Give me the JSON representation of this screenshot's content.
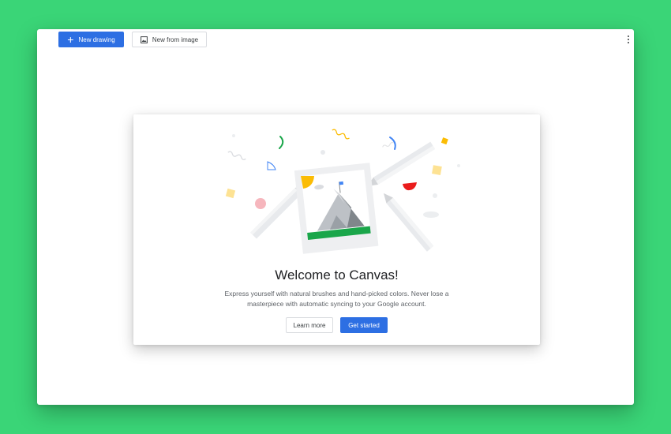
{
  "toolbar": {
    "new_drawing_label": "New drawing",
    "new_from_image_label": "New from image",
    "plus_icon": "plus-icon",
    "image_icon": "image-icon",
    "menu_icon": "more-vert-icon"
  },
  "welcome": {
    "title": "Welcome to Canvas!",
    "description": "Express yourself with natural brushes and hand-picked colors. Never lose a masterpiece with automatic syncing to your Google account.",
    "learn_more_label": "Learn more",
    "get_started_label": "Get started"
  },
  "colors": {
    "background": "#3ad577",
    "accent": "#2d6fe3",
    "yellow": "#fbbc04",
    "red": "#ea1c1c",
    "green": "#1aa64a",
    "blue": "#4285f4"
  }
}
